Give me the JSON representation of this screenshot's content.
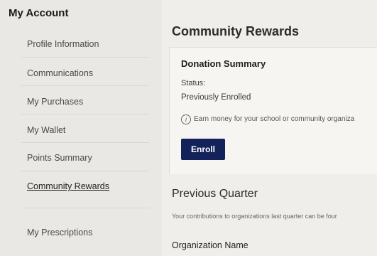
{
  "sidebar": {
    "title": "My Account",
    "items": [
      {
        "label": "Profile Information",
        "active": false
      },
      {
        "label": "Communications",
        "active": false
      },
      {
        "label": "My Purchases",
        "active": false
      },
      {
        "label": "My Wallet",
        "active": false
      },
      {
        "label": "Points Summary",
        "active": false
      },
      {
        "label": "Community Rewards",
        "active": true
      },
      {
        "label": "My Prescriptions",
        "active": false
      }
    ]
  },
  "main": {
    "title": "Community Rewards",
    "donation_card": {
      "title": "Donation Summary",
      "status_label": "Status:",
      "status_value": "Previously Enrolled",
      "info_icon": "info-icon",
      "info_text": "Earn money for your school or community organiza",
      "enroll_label": "Enroll",
      "enroll_color": "#13235a"
    },
    "previous_quarter": {
      "title": "Previous Quarter",
      "description": "Your contributions to organizations last quarter can be four",
      "column_header": "Organization Name"
    }
  }
}
